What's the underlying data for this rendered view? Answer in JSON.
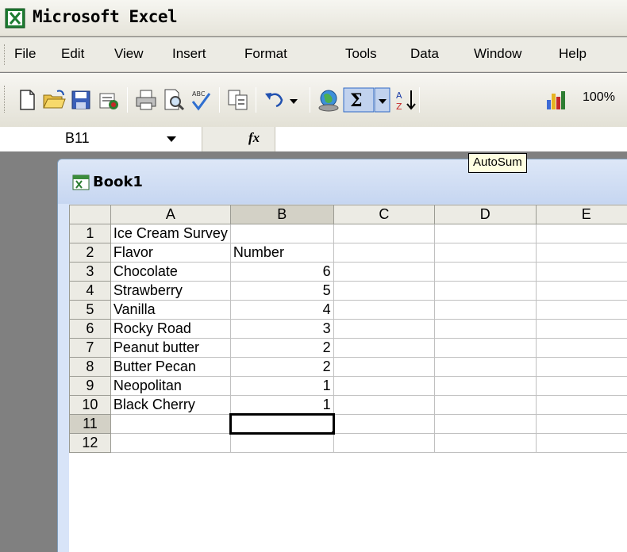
{
  "app": {
    "title": "Microsoft Excel",
    "logo_icon": "excel-logo-icon"
  },
  "menu": [
    "File",
    "Edit",
    "View",
    "Insert",
    "Format",
    "Tools",
    "Data",
    "Window",
    "Help"
  ],
  "toolbar": {
    "icons": [
      "new-icon",
      "open-icon",
      "save-icon",
      "permission-icon",
      "print-icon",
      "print-preview-icon",
      "spelling-icon",
      "copy-icon",
      "undo-icon",
      "undo-dropdown-icon",
      "hyperlink-icon",
      "autosum-icon",
      "autosum-dropdown-icon",
      "sort-ascending-icon",
      "chart-wizard-icon"
    ],
    "zoom": "100%"
  },
  "formula_bar": {
    "name_box": "B11",
    "fx": "fx",
    "formula": ""
  },
  "tooltip": "AutoSum",
  "workbook": {
    "title": "Book1",
    "columns": [
      "A",
      "B",
      "C",
      "D",
      "E"
    ],
    "selected_column": "B",
    "selected_row": "11",
    "rows": [
      {
        "num": "1",
        "A": "Ice Cream Survey",
        "B": ""
      },
      {
        "num": "2",
        "A": "Flavor",
        "B": "Number"
      },
      {
        "num": "3",
        "A": "Chocolate",
        "B": "6"
      },
      {
        "num": "4",
        "A": "Strawberry",
        "B": "5"
      },
      {
        "num": "5",
        "A": "Vanilla",
        "B": "4"
      },
      {
        "num": "6",
        "A": "Rocky Road",
        "B": "3"
      },
      {
        "num": "7",
        "A": "Peanut butter",
        "B": "2"
      },
      {
        "num": "8",
        "A": "Butter Pecan",
        "B": "2"
      },
      {
        "num": "9",
        "A": "Neopolitan",
        "B": "1"
      },
      {
        "num": "10",
        "A": "Black Cherry",
        "B": "1"
      },
      {
        "num": "11",
        "A": "",
        "B": ""
      },
      {
        "num": "12",
        "A": "",
        "B": ""
      }
    ]
  }
}
